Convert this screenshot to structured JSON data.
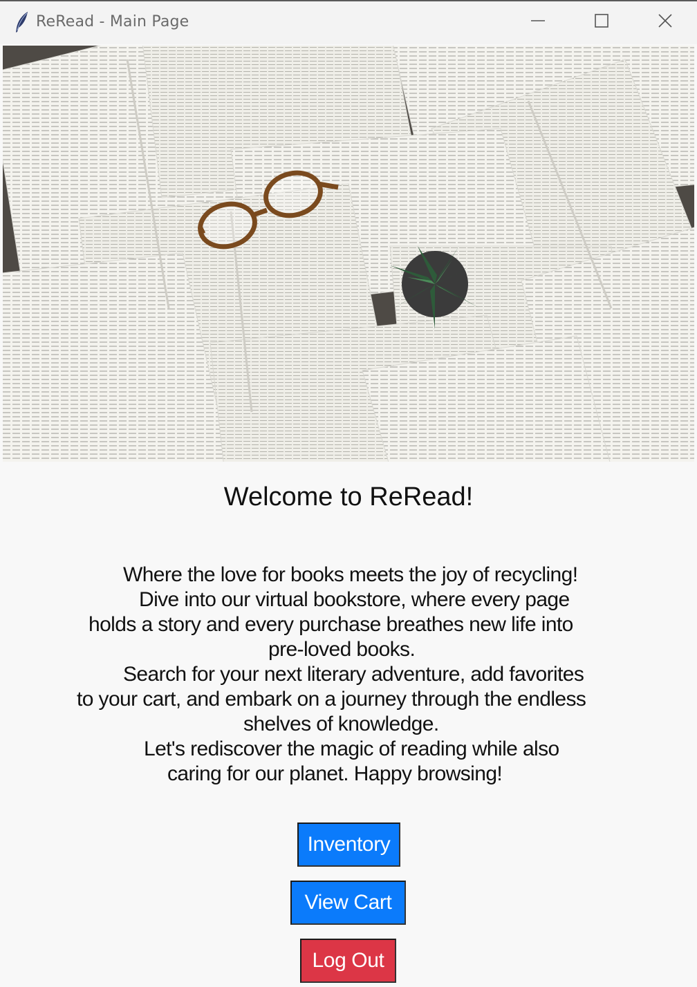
{
  "window": {
    "title": "ReRead - Main Page",
    "controls": {
      "minimize": "minimize-icon",
      "maximize": "maximize-icon",
      "close": "close-icon"
    }
  },
  "banner": {
    "icon": "books-photo"
  },
  "main": {
    "welcome": "Welcome to ReRead!",
    "intro_lines": [
      "Where the love for books meets the joy of recycling!",
      "Dive into our virtual bookstore, where every page",
      "holds a story and every purchase breathes new life into",
      "pre-loved books.",
      "Search for your next literary adventure, add favorites",
      "to your cart, and embark on a journey through the endless",
      "shelves of knowledge.",
      "Let's rediscover the magic of reading while also",
      "caring for our planet. Happy browsing!"
    ]
  },
  "buttons": {
    "inventory": "Inventory",
    "view_cart": "View Cart",
    "log_out": "Log Out"
  },
  "colors": {
    "primary_button": "#0b7bfb",
    "danger_button": "#dc3646",
    "background": "#f8f8f8"
  }
}
